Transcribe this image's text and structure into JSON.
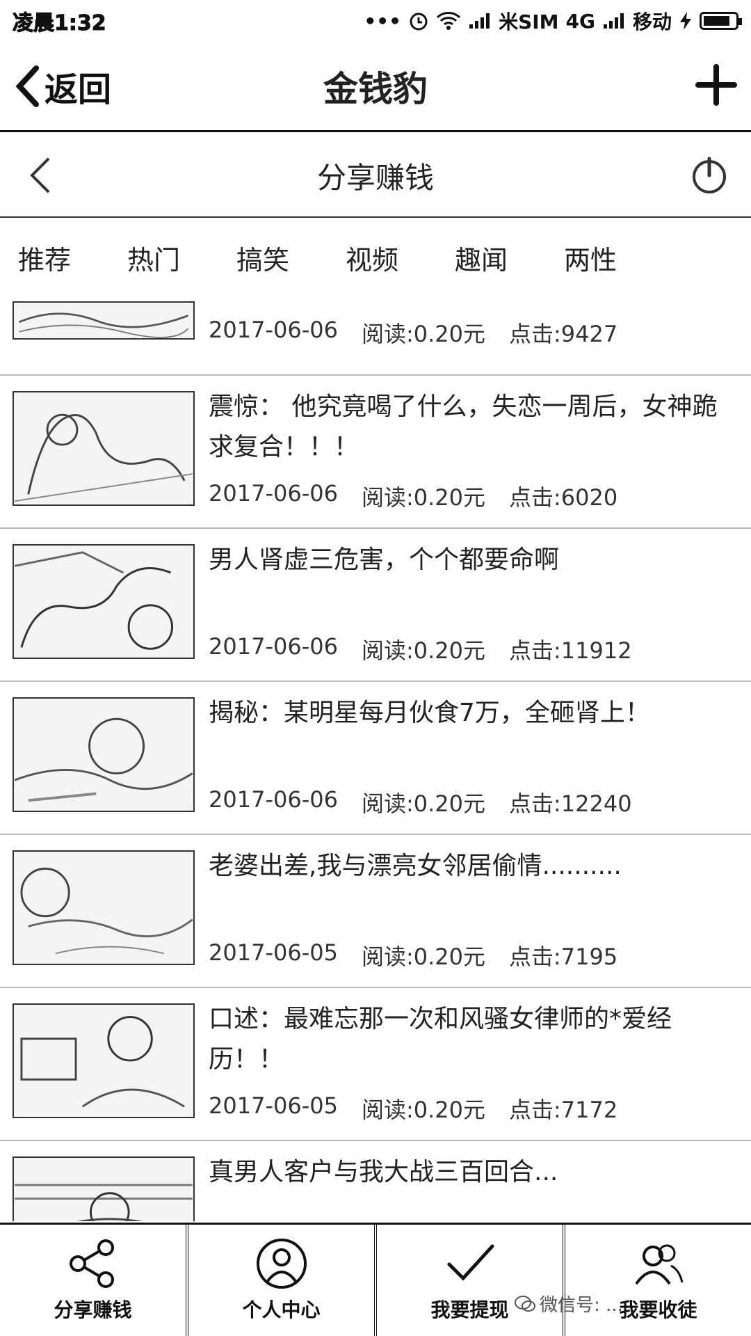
{
  "status_bar": {
    "time": "凌晨1:32",
    "sim": "米SIM",
    "network": "4G",
    "carrier": "移动",
    "battery_level": 0.85,
    "icons": [
      "dots-icon",
      "alarm-icon",
      "wifi-icon",
      "signal-icon",
      "signal-icon",
      "charging-icon",
      "battery-icon"
    ]
  },
  "app_header": {
    "back_label": "返回",
    "title": "金钱豹",
    "add_icon": "plus-icon"
  },
  "sub_header": {
    "title": "分享赚钱",
    "back_icon": "chevron-left-icon",
    "power_icon": "power-icon"
  },
  "tabs": [
    "推荐",
    "热门",
    "搞笑",
    "视频",
    "趣闻",
    "两性"
  ],
  "articles": [
    {
      "title": "",
      "date": "2017-06-06",
      "read": "阅读:0.20元",
      "clicks": "点击:9427"
    },
    {
      "title": "震惊：  他究竟喝了什么，失恋一周后，女神跪求复合！！！",
      "date": "2017-06-06",
      "read": "阅读:0.20元",
      "clicks": "点击:6020"
    },
    {
      "title": "男人肾虚三危害，个个都要命啊",
      "date": "2017-06-06",
      "read": "阅读:0.20元",
      "clicks": "点击:11912"
    },
    {
      "title": "揭秘：某明星每月伙食7万，全砸肾上！",
      "date": "2017-06-06",
      "read": "阅读:0.20元",
      "clicks": "点击:12240"
    },
    {
      "title": "老婆出差,我与漂亮女邻居偷情..........",
      "date": "2017-06-05",
      "read": "阅读:0.20元",
      "clicks": "点击:7195"
    },
    {
      "title": "口述：最难忘那一次和风骚女律师的*爱经历！！",
      "date": "2017-06-05",
      "read": "阅读:0.20元",
      "clicks": "点击:7172"
    },
    {
      "title": "真男人客户与我大战三百回合...",
      "date": "",
      "read": "",
      "clicks": ""
    }
  ],
  "bottom_nav": [
    {
      "label": "分享赚钱",
      "icon": "share-icon"
    },
    {
      "label": "个人中心",
      "icon": "user-icon"
    },
    {
      "label": "我要提现",
      "icon": "check-icon"
    },
    {
      "label": "我要收徒",
      "icon": "users-icon"
    }
  ],
  "watermark": "微信号: ..."
}
